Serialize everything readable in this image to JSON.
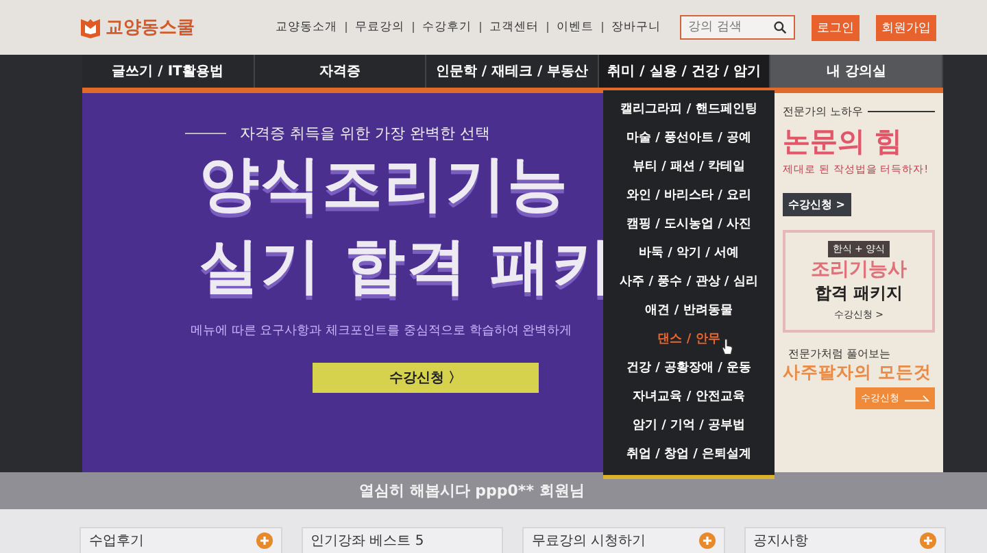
{
  "header": {
    "logo": "교양동스쿨",
    "links": [
      "교양동소개",
      "무료강의",
      "수강후기",
      "고객센터",
      "이벤트",
      "장바구니"
    ],
    "search": {
      "placeholder": "강의 검색"
    },
    "buttons": [
      "로그인",
      "회원가입"
    ]
  },
  "nav": [
    {
      "label": "글쓰기 / IT활용법",
      "selected": false,
      "kind": "main"
    },
    {
      "label": "자격증",
      "selected": false,
      "kind": "main"
    },
    {
      "label": "인문학 / 재테크 / 부동산",
      "selected": false,
      "kind": "main"
    },
    {
      "label": "취미 / 실용 / 건강 / 암기",
      "selected": true,
      "kind": "main"
    },
    {
      "label": "내 강의실",
      "selected": false,
      "kind": "mypage"
    }
  ],
  "dropdown": [
    {
      "label": "캘리그라피 / 핸드페인팅",
      "hovered": false
    },
    {
      "label": "마술 / 풍선아트 / 공예",
      "hovered": false
    },
    {
      "label": "뷰티 / 패션 / 칵테일",
      "hovered": false
    },
    {
      "label": "와인 / 바리스타 / 요리",
      "hovered": false
    },
    {
      "label": "캠핑 / 도시농업 / 사진",
      "hovered": false
    },
    {
      "label": "바둑 / 악기 / 서예",
      "hovered": false
    },
    {
      "label": "사주 / 풍수 / 관상 / 심리",
      "hovered": false
    },
    {
      "label": "애견 / 반려동물",
      "hovered": false
    },
    {
      "label": "댄스 / 안무",
      "hovered": true
    },
    {
      "label": "건강 / 공황장애 / 운동",
      "hovered": false
    },
    {
      "label": "자녀교육 / 안전교육",
      "hovered": false
    },
    {
      "label": "암기 / 기억 / 공부법",
      "hovered": false
    },
    {
      "label": "취업 / 창업 / 은퇴설계",
      "hovered": false
    }
  ],
  "banner": {
    "tagline": "자격증 취득을 위한 가장 완벽한 선택",
    "headline": [
      "양식조리기능",
      "실기 합격 패키"
    ],
    "description": "메뉴에 따른 요구사항과 체크포인트를 중심적으로 학습하여 완벽하게",
    "button": "수강신청 〉"
  },
  "side_ads": [
    {
      "kind": "thesis",
      "kicker": "전문가의 노하우",
      "title": "논문의 힘",
      "text": "제대로 된 작성법을 터득하자!",
      "button": "수강신청 >"
    },
    {
      "kind": "cooking",
      "tag": "한식 + 양식",
      "title": "조리기능사",
      "subtitle": "합격 패키지",
      "button": "수강신청 >"
    },
    {
      "kind": "saju",
      "kicker": "전문가처럼 풀어보는",
      "title": "사주팔자의 모든것",
      "button": "수강신청"
    }
  ],
  "ticker": "열심히 해봅시다 ppp0** 회원님",
  "boxes": [
    {
      "title": "수업후기",
      "more": true
    },
    {
      "title": "인기강좌 베스트 5",
      "more": false
    },
    {
      "title": "무료강의 시청하기",
      "more": true
    },
    {
      "title": "공지사항",
      "more": true
    }
  ]
}
